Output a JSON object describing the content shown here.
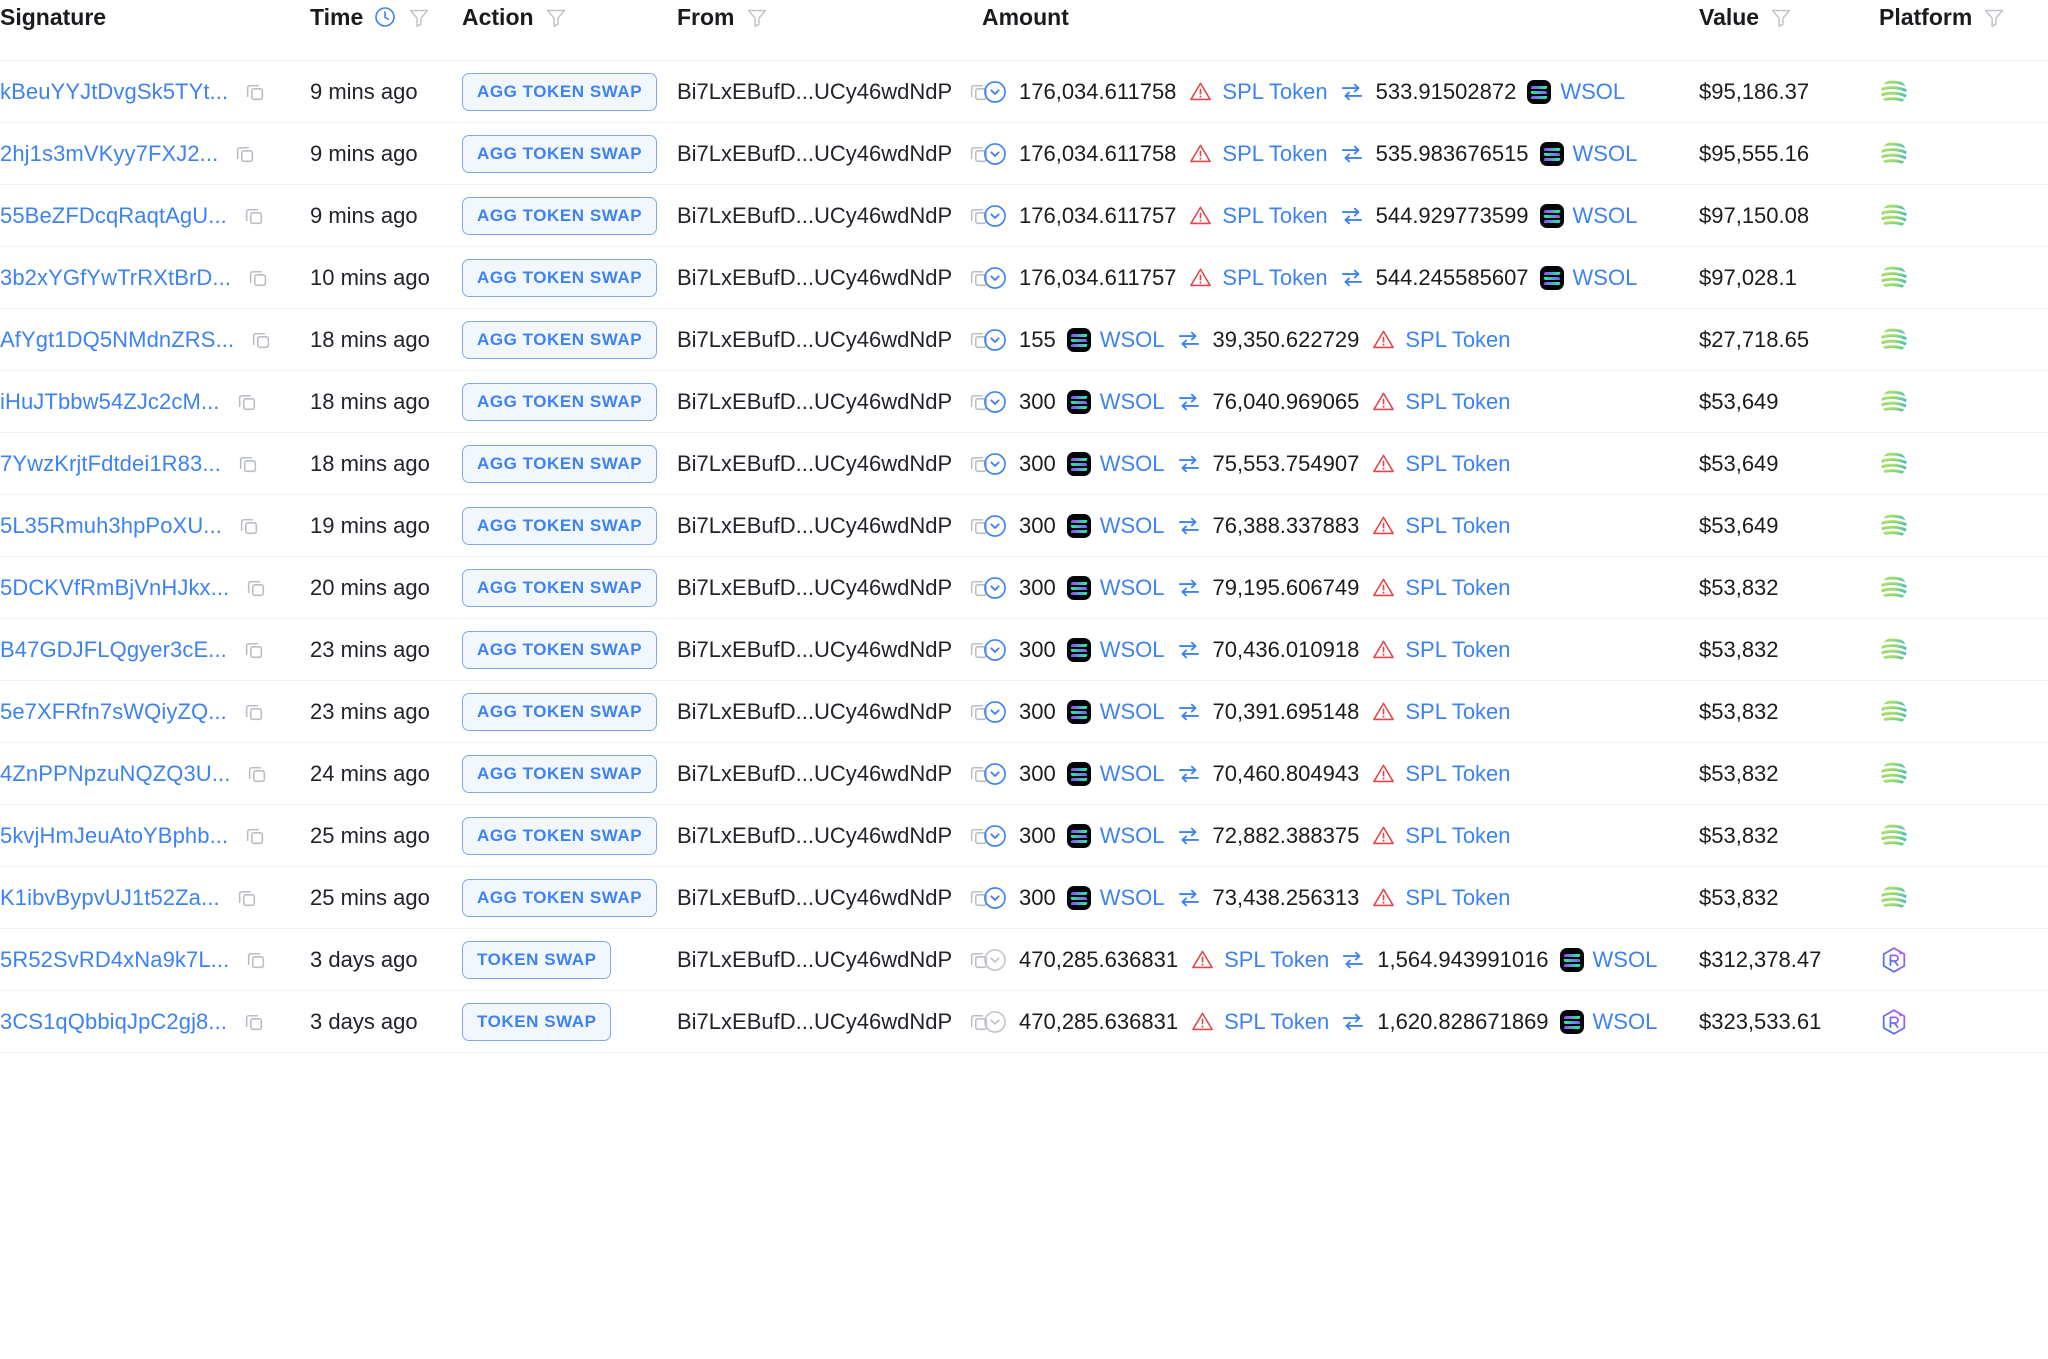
{
  "colors": {
    "link_blue": "#3d82f2",
    "badge_border": "#7fa9ef",
    "badge_bg": "#f2f7fe",
    "warning_red": "#e0474c",
    "text_dark": "#1b1b1f",
    "row_divider": "#f0f1f3",
    "chevron_blue": "#3d82f2",
    "chevron_gray": "#c3c6cc",
    "jupiter_green": "#8fd47e",
    "jupiter_teal": "#3bbfc4",
    "raydium_purple": "#8c65f7",
    "raydium_blue": "#3f7ae0"
  },
  "table": {
    "columns": [
      {
        "key": "signature",
        "label": "Signature",
        "has_filter": false,
        "has_clock": false
      },
      {
        "key": "time",
        "label": "Time",
        "has_filter": true,
        "has_clock": true
      },
      {
        "key": "action",
        "label": "Action",
        "has_filter": true,
        "has_clock": false
      },
      {
        "key": "from",
        "label": "From",
        "has_filter": true,
        "has_clock": false
      },
      {
        "key": "amount",
        "label": "Amount",
        "has_filter": false,
        "has_clock": false
      },
      {
        "key": "value",
        "label": "Value",
        "has_filter": true,
        "has_clock": false
      },
      {
        "key": "platform",
        "label": "Platform",
        "has_filter": true,
        "has_clock": false
      }
    ],
    "rows": [
      {
        "signature": "kBeuYYJtDvgSk5TYt...",
        "time": "9 mins ago",
        "action": "AGG TOKEN SWAP",
        "from": "Bi7LxEBufD...UCy46wdNdP",
        "amount": {
          "status_icon": "chevron-down-circle-icon",
          "status_active": true,
          "in_value": "176,034.611758",
          "in_token": "SPL Token",
          "in_token_icon": "warning-triangle-icon",
          "out_value": "533.91502872",
          "out_token": "WSOL",
          "out_token_icon": "solana-token-icon"
        },
        "value": "$95,186.37",
        "platform": "jupiter-logo-icon"
      },
      {
        "signature": "2hj1s3mVKyy7FXJ2...",
        "time": "9 mins ago",
        "action": "AGG TOKEN SWAP",
        "from": "Bi7LxEBufD...UCy46wdNdP",
        "amount": {
          "status_icon": "chevron-down-circle-icon",
          "status_active": true,
          "in_value": "176,034.611758",
          "in_token": "SPL Token",
          "in_token_icon": "warning-triangle-icon",
          "out_value": "535.983676515",
          "out_token": "WSOL",
          "out_token_icon": "solana-token-icon"
        },
        "value": "$95,555.16",
        "platform": "jupiter-logo-icon"
      },
      {
        "signature": "55BeZFDcqRaqtAgU...",
        "time": "9 mins ago",
        "action": "AGG TOKEN SWAP",
        "from": "Bi7LxEBufD...UCy46wdNdP",
        "amount": {
          "status_icon": "chevron-down-circle-icon",
          "status_active": true,
          "in_value": "176,034.611757",
          "in_token": "SPL Token",
          "in_token_icon": "warning-triangle-icon",
          "out_value": "544.929773599",
          "out_token": "WSOL",
          "out_token_icon": "solana-token-icon"
        },
        "value": "$97,150.08",
        "platform": "jupiter-logo-icon"
      },
      {
        "signature": "3b2xYGfYwTrRXtBrD...",
        "time": "10 mins ago",
        "action": "AGG TOKEN SWAP",
        "from": "Bi7LxEBufD...UCy46wdNdP",
        "amount": {
          "status_icon": "chevron-down-circle-icon",
          "status_active": true,
          "in_value": "176,034.611757",
          "in_token": "SPL Token",
          "in_token_icon": "warning-triangle-icon",
          "out_value": "544.245585607",
          "out_token": "WSOL",
          "out_token_icon": "solana-token-icon"
        },
        "value": "$97,028.1",
        "platform": "jupiter-logo-icon"
      },
      {
        "signature": "AfYgt1DQ5NMdnZRS...",
        "time": "18 mins ago",
        "action": "AGG TOKEN SWAP",
        "from": "Bi7LxEBufD...UCy46wdNdP",
        "amount": {
          "status_icon": "chevron-down-circle-icon",
          "status_active": true,
          "in_value": "155",
          "in_token": "WSOL",
          "in_token_icon": "solana-token-icon",
          "out_value": "39,350.622729",
          "out_token": "SPL Token",
          "out_token_icon": "warning-triangle-icon"
        },
        "value": "$27,718.65",
        "platform": "jupiter-logo-icon"
      },
      {
        "signature": "iHuJTbbw54ZJc2cM...",
        "time": "18 mins ago",
        "action": "AGG TOKEN SWAP",
        "from": "Bi7LxEBufD...UCy46wdNdP",
        "amount": {
          "status_icon": "chevron-down-circle-icon",
          "status_active": true,
          "in_value": "300",
          "in_token": "WSOL",
          "in_token_icon": "solana-token-icon",
          "out_value": "76,040.969065",
          "out_token": "SPL Token",
          "out_token_icon": "warning-triangle-icon"
        },
        "value": "$53,649",
        "platform": "jupiter-logo-icon"
      },
      {
        "signature": "7YwzKrjtFdtdei1R83...",
        "time": "18 mins ago",
        "action": "AGG TOKEN SWAP",
        "from": "Bi7LxEBufD...UCy46wdNdP",
        "amount": {
          "status_icon": "chevron-down-circle-icon",
          "status_active": true,
          "in_value": "300",
          "in_token": "WSOL",
          "in_token_icon": "solana-token-icon",
          "out_value": "75,553.754907",
          "out_token": "SPL Token",
          "out_token_icon": "warning-triangle-icon"
        },
        "value": "$53,649",
        "platform": "jupiter-logo-icon"
      },
      {
        "signature": "5L35Rmuh3hpPoXU...",
        "time": "19 mins ago",
        "action": "AGG TOKEN SWAP",
        "from": "Bi7LxEBufD...UCy46wdNdP",
        "amount": {
          "status_icon": "chevron-down-circle-icon",
          "status_active": true,
          "in_value": "300",
          "in_token": "WSOL",
          "in_token_icon": "solana-token-icon",
          "out_value": "76,388.337883",
          "out_token": "SPL Token",
          "out_token_icon": "warning-triangle-icon"
        },
        "value": "$53,649",
        "platform": "jupiter-logo-icon"
      },
      {
        "signature": "5DCKVfRmBjVnHJkx...",
        "time": "20 mins ago",
        "action": "AGG TOKEN SWAP",
        "from": "Bi7LxEBufD...UCy46wdNdP",
        "amount": {
          "status_icon": "chevron-down-circle-icon",
          "status_active": true,
          "in_value": "300",
          "in_token": "WSOL",
          "in_token_icon": "solana-token-icon",
          "out_value": "79,195.606749",
          "out_token": "SPL Token",
          "out_token_icon": "warning-triangle-icon"
        },
        "value": "$53,832",
        "platform": "jupiter-logo-icon"
      },
      {
        "signature": "B47GDJFLQgyer3cE...",
        "time": "23 mins ago",
        "action": "AGG TOKEN SWAP",
        "from": "Bi7LxEBufD...UCy46wdNdP",
        "amount": {
          "status_icon": "chevron-down-circle-icon",
          "status_active": true,
          "in_value": "300",
          "in_token": "WSOL",
          "in_token_icon": "solana-token-icon",
          "out_value": "70,436.010918",
          "out_token": "SPL Token",
          "out_token_icon": "warning-triangle-icon"
        },
        "value": "$53,832",
        "platform": "jupiter-logo-icon"
      },
      {
        "signature": "5e7XFRfn7sWQiyZQ...",
        "time": "23 mins ago",
        "action": "AGG TOKEN SWAP",
        "from": "Bi7LxEBufD...UCy46wdNdP",
        "amount": {
          "status_icon": "chevron-down-circle-icon",
          "status_active": true,
          "in_value": "300",
          "in_token": "WSOL",
          "in_token_icon": "solana-token-icon",
          "out_value": "70,391.695148",
          "out_token": "SPL Token",
          "out_token_icon": "warning-triangle-icon"
        },
        "value": "$53,832",
        "platform": "jupiter-logo-icon"
      },
      {
        "signature": "4ZnPPNpzuNQZQ3U...",
        "time": "24 mins ago",
        "action": "AGG TOKEN SWAP",
        "from": "Bi7LxEBufD...UCy46wdNdP",
        "amount": {
          "status_icon": "chevron-down-circle-icon",
          "status_active": true,
          "in_value": "300",
          "in_token": "WSOL",
          "in_token_icon": "solana-token-icon",
          "out_value": "70,460.804943",
          "out_token": "SPL Token",
          "out_token_icon": "warning-triangle-icon"
        },
        "value": "$53,832",
        "platform": "jupiter-logo-icon"
      },
      {
        "signature": "5kvjHmJeuAtoYBphb...",
        "time": "25 mins ago",
        "action": "AGG TOKEN SWAP",
        "from": "Bi7LxEBufD...UCy46wdNdP",
        "amount": {
          "status_icon": "chevron-down-circle-icon",
          "status_active": true,
          "in_value": "300",
          "in_token": "WSOL",
          "in_token_icon": "solana-token-icon",
          "out_value": "72,882.388375",
          "out_token": "SPL Token",
          "out_token_icon": "warning-triangle-icon"
        },
        "value": "$53,832",
        "platform": "jupiter-logo-icon"
      },
      {
        "signature": "K1ibvBypvUJ1t52Za...",
        "time": "25 mins ago",
        "action": "AGG TOKEN SWAP",
        "from": "Bi7LxEBufD...UCy46wdNdP",
        "amount": {
          "status_icon": "chevron-down-circle-icon",
          "status_active": true,
          "in_value": "300",
          "in_token": "WSOL",
          "in_token_icon": "solana-token-icon",
          "out_value": "73,438.256313",
          "out_token": "SPL Token",
          "out_token_icon": "warning-triangle-icon"
        },
        "value": "$53,832",
        "platform": "jupiter-logo-icon"
      },
      {
        "signature": "5R52SvRD4xNa9k7L...",
        "time": "3 days ago",
        "action": "TOKEN SWAP",
        "from": "Bi7LxEBufD...UCy46wdNdP",
        "amount": {
          "status_icon": "chevron-down-circle-icon",
          "status_active": false,
          "in_value": "470,285.636831",
          "in_token": "SPL Token",
          "in_token_icon": "warning-triangle-icon",
          "out_value": "1,564.943991016",
          "out_token": "WSOL",
          "out_token_icon": "solana-token-icon"
        },
        "value": "$312,378.47",
        "platform": "raydium-logo-icon"
      },
      {
        "signature": "3CS1qQbbiqJpC2gj8...",
        "time": "3 days ago",
        "action": "TOKEN SWAP",
        "from": "Bi7LxEBufD...UCy46wdNdP",
        "amount": {
          "status_icon": "chevron-down-circle-icon",
          "status_active": false,
          "in_value": "470,285.636831",
          "in_token": "SPL Token",
          "in_token_icon": "warning-triangle-icon",
          "out_value": "1,620.828671869",
          "out_token": "WSOL",
          "out_token_icon": "solana-token-icon"
        },
        "value": "$323,533.61",
        "platform": "raydium-logo-icon"
      }
    ]
  }
}
